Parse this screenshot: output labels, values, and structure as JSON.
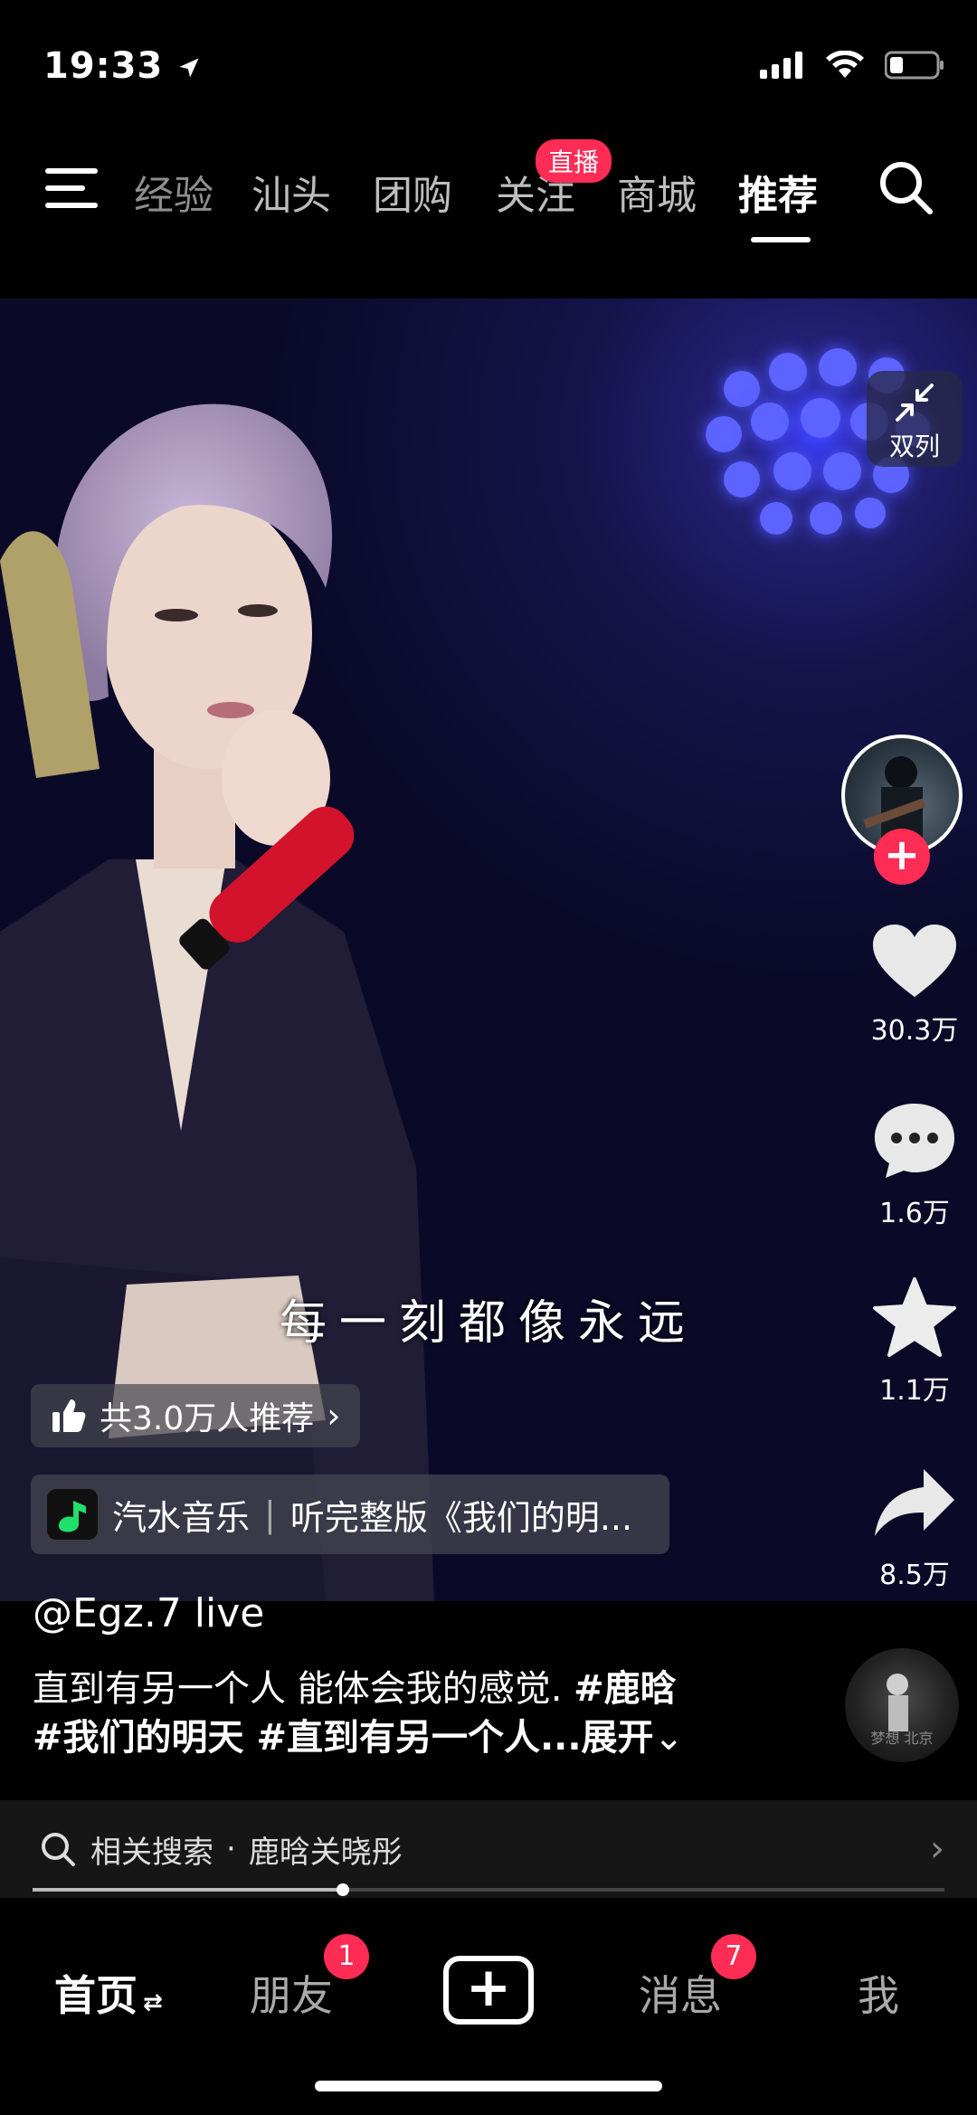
{
  "status_bar": {
    "time": "19:33"
  },
  "top_tabs": {
    "items": [
      "经验",
      "汕头",
      "团购",
      "关注",
      "商城",
      "推荐"
    ],
    "active": "推荐",
    "live_badge": "直播"
  },
  "video": {
    "subtitle": "每一刻都像永远",
    "recommend_text": "共3.0万人推荐",
    "music_app": "汽水音乐",
    "music_action": "听完整版《我们的明..."
  },
  "right_rail": {
    "dual_column_label": "双列",
    "likes": "30.3万",
    "comments": "1.6万",
    "favorites": "1.1万",
    "shares": "8.5万",
    "disc_caption": "梦想 北京"
  },
  "post": {
    "author": "@Egz.7 live",
    "caption_line1": "直到有另一个人 能体会我的感觉.",
    "tag1": "#鹿晗",
    "caption_line2_tags": "#我们的明天 #直到有另一个人...",
    "expand": "展开"
  },
  "related_search": {
    "label": "相关搜索",
    "dot": "·",
    "query": "鹿晗关晓彤"
  },
  "progress": {
    "fraction": 0.34
  },
  "bottom_nav": {
    "home": "首页",
    "friends": "朋友",
    "friends_badge": "1",
    "messages": "消息",
    "messages_badge": "7",
    "me": "我"
  },
  "colors": {
    "accent": "#ff2c55",
    "background": "#000000"
  }
}
